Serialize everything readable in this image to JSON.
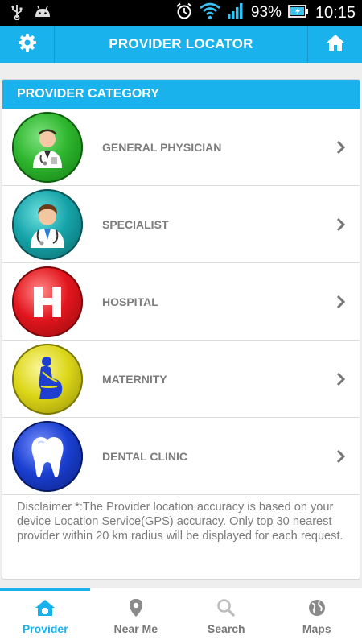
{
  "status_bar": {
    "battery": "93%",
    "time": "10:15",
    "icons": [
      "usb-icon",
      "android-icon",
      "alarm-icon",
      "wifi-icon",
      "signal-icon",
      "battery-icon"
    ]
  },
  "app_bar": {
    "title": "PROVIDER LOCATOR",
    "left_icon": "gear-icon",
    "right_icon": "home-icon"
  },
  "category": {
    "header": "PROVIDER CATEGORY",
    "items": [
      {
        "label": "GENERAL PHYSICIAN",
        "icon": "physician-icon",
        "color": "#1f9a1f"
      },
      {
        "label": "SPECIALIST",
        "icon": "specialist-icon",
        "color": "#0f8f94"
      },
      {
        "label": "HOSPITAL",
        "icon": "hospital-icon",
        "color": "#d8161c"
      },
      {
        "label": "MATERNITY",
        "icon": "maternity-icon",
        "color": "#d6d10b"
      },
      {
        "label": "DENTAL CLINIC",
        "icon": "tooth-icon",
        "color": "#1636b5"
      }
    ],
    "disclaimer": "Disclaimer *:The Provider location accuracy is based on your device Location Service(GPS) accuracy. Only top 30 nearest provider within 20 km radius will be displayed for each request."
  },
  "bottom_nav": {
    "tabs": [
      {
        "label": "Provider",
        "icon": "provider-icon",
        "active": true
      },
      {
        "label": "Near Me",
        "icon": "location-pin-icon",
        "active": false
      },
      {
        "label": "Search",
        "icon": "search-icon",
        "active": false
      },
      {
        "label": "Maps",
        "icon": "globe-icon",
        "active": false
      }
    ]
  },
  "colors": {
    "accent": "#1ab2ec",
    "text_gray": "#7c7c7c"
  }
}
